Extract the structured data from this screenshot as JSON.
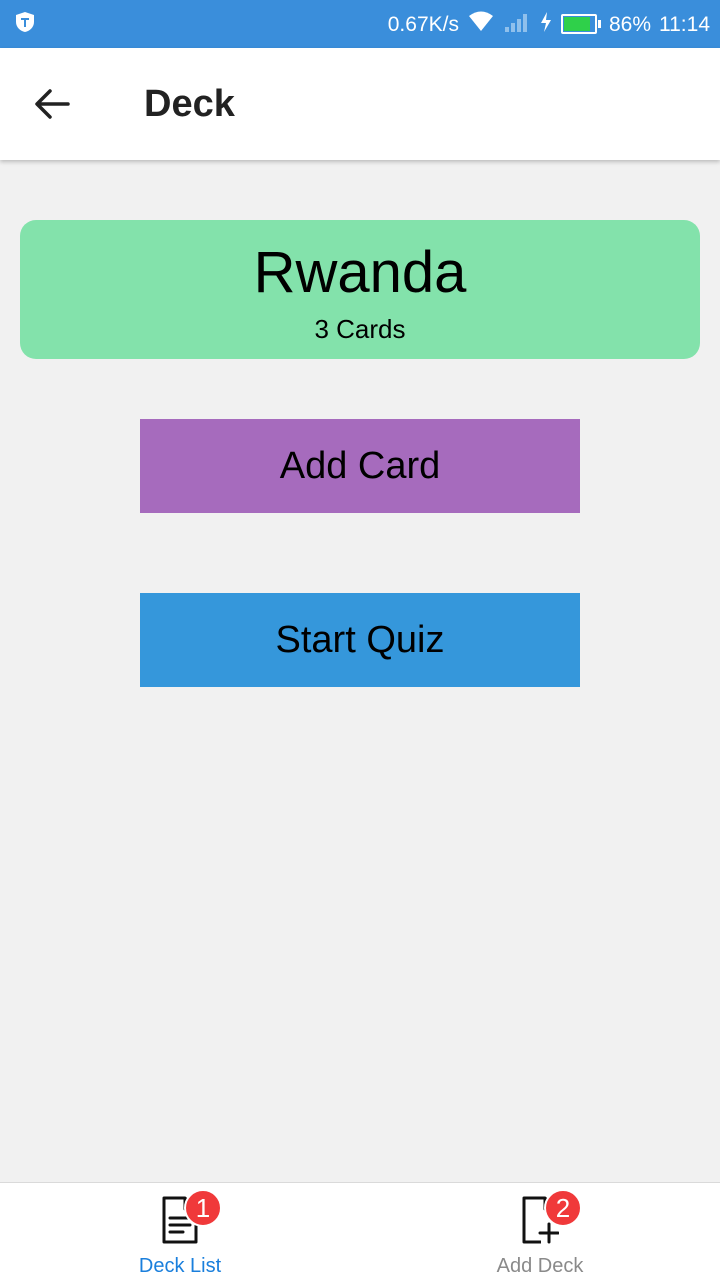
{
  "status_bar": {
    "network_speed": "0.67K/s",
    "battery_percent": "86%",
    "time": "11:14",
    "battery_level": 0.86,
    "icons": [
      "shield-icon",
      "wifi-icon",
      "signal-icon",
      "charging-icon",
      "battery-icon"
    ]
  },
  "app_bar": {
    "title": "Deck",
    "back_icon": "arrow-left-icon"
  },
  "deck": {
    "title": "Rwanda",
    "count": "3 Cards"
  },
  "actions": {
    "add_card": "Add Card",
    "start_quiz": "Start Quiz"
  },
  "bottom_nav": {
    "tabs": [
      {
        "label": "Deck List",
        "badge": "1",
        "icon": "document-icon",
        "active": true
      },
      {
        "label": "Add Deck",
        "badge": "2",
        "icon": "document-add-icon",
        "active": false
      }
    ]
  },
  "colors": {
    "status_bar": "#3a8edb",
    "deck_card": "#83e2ab",
    "add_card": "#a66bbd",
    "start_quiz": "#3597db",
    "active_tab": "#1a7fdc",
    "badge": "#f0393a"
  }
}
